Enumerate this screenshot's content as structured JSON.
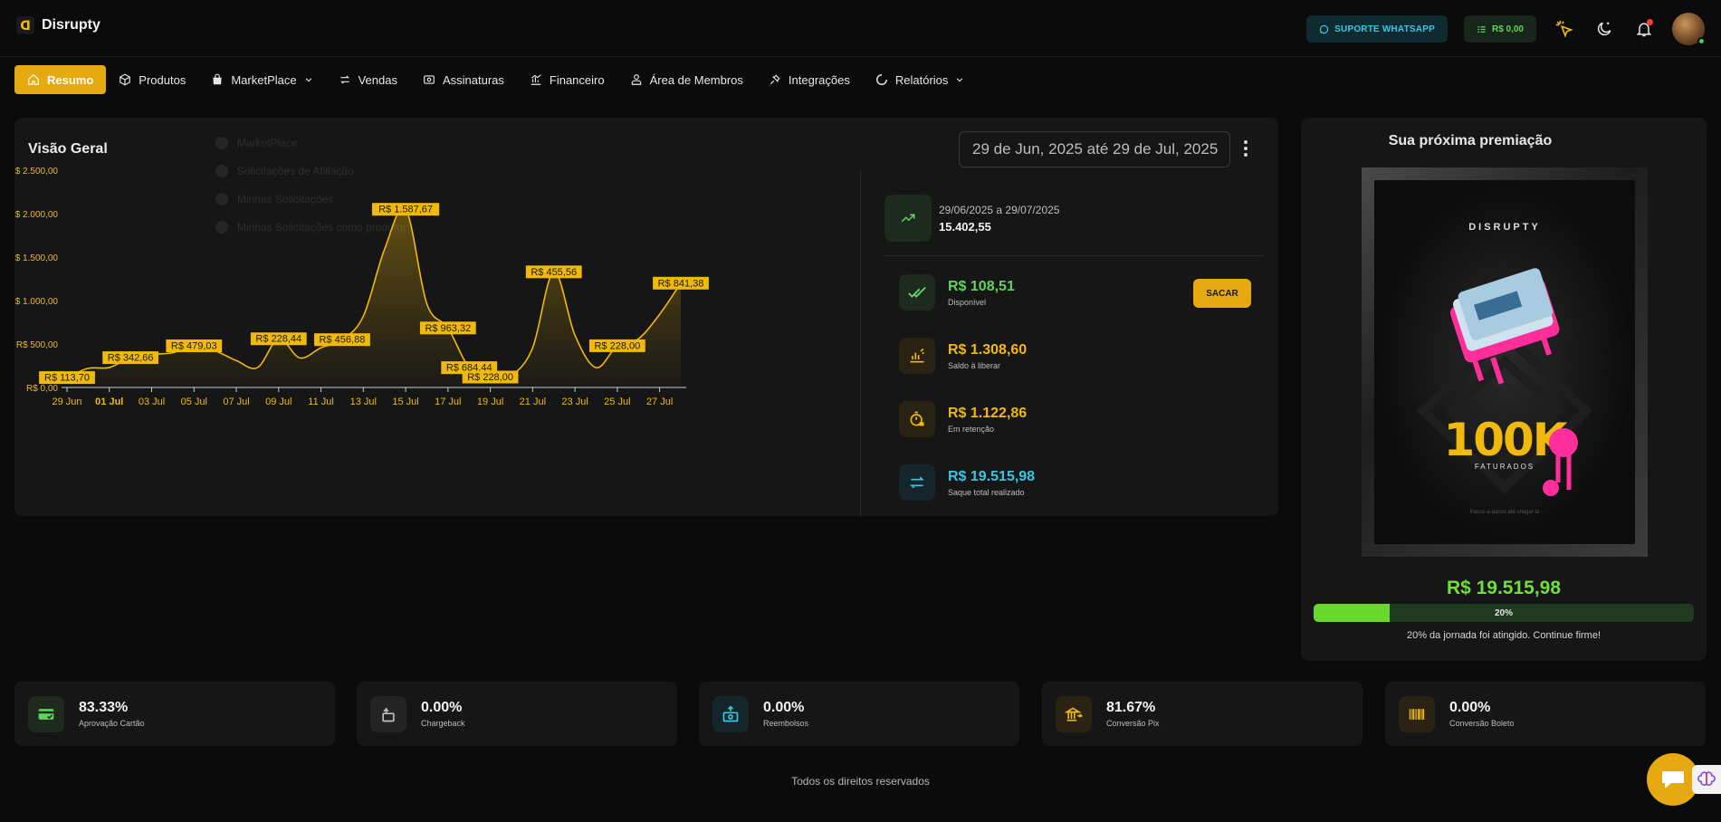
{
  "app": {
    "name": "Disrupty"
  },
  "topbar": {
    "support_label": "SUPORTE WHATSAPP",
    "balance_label": "R$ 0,00"
  },
  "nav": [
    {
      "label": "Resumo",
      "icon": "home-icon",
      "active": true
    },
    {
      "label": "Produtos",
      "icon": "box-icon"
    },
    {
      "label": "MarketPlace",
      "icon": "shopping-bag-icon",
      "dropdown": true
    },
    {
      "label": "Vendas",
      "icon": "arrows-swap-icon"
    },
    {
      "label": "Assinaturas",
      "icon": "subscription-icon"
    },
    {
      "label": "Financeiro",
      "icon": "finance-chart-icon"
    },
    {
      "label": "Área de Membros",
      "icon": "members-icon"
    },
    {
      "label": "Integrações",
      "icon": "plug-icon"
    },
    {
      "label": "Relatórios",
      "icon": "report-circle-icon",
      "dropdown": true
    }
  ],
  "overview": {
    "title": "Visão Geral",
    "date_range": "29 de Jun, 2025 até 29 de Jul, 2025",
    "legend": [
      "MarketPlace",
      "Solicitações de Afiliação",
      "Minhas Solicitações",
      "Minhas Solicitações como produtor"
    ]
  },
  "summary": {
    "range": "29/06/2025 a 29/07/2025",
    "total": "15.402,55"
  },
  "finance": [
    {
      "value": "R$ 108,51",
      "label": "Disponível",
      "color": "#62d35c",
      "icon": "double-check-icon"
    },
    {
      "value": "R$ 1.308,60",
      "label": "Saldo à liberar",
      "color": "#f0b90b",
      "icon": "hand-coins-icon"
    },
    {
      "value": "R$ 1.122,86",
      "label": "Em retenção",
      "color": "#f0b90b",
      "icon": "timer-lock-icon"
    },
    {
      "value": "R$ 19.515,98",
      "label": "Saque total realizado",
      "color": "#39c6e0",
      "icon": "transfer-icon"
    }
  ],
  "withdraw_label": "SACAR",
  "award": {
    "title": "Sua próxima premiação",
    "brand": "DISRUPTY",
    "headline": "100K",
    "sub": "FATURADOS",
    "footnote": "Passo-a-passo até chegar lá",
    "amount": "R$ 19.515,98",
    "progress": 0.2,
    "progress_label": "20%",
    "note": "20% da jornada foi atingido. Continue firme!"
  },
  "metrics": [
    {
      "value": "83.33%",
      "label": "Aprovação Cartão",
      "icon": "credit-card-check-icon",
      "color": "#62d35c"
    },
    {
      "value": "0.00%",
      "label": "Chargeback",
      "icon": "card-reverse-icon",
      "color": "#bdbdbd"
    },
    {
      "value": "0.00%",
      "label": "Reembolsos",
      "icon": "refund-icon",
      "color": "#39c6e0"
    },
    {
      "value": "81.67%",
      "label": "Conversão Pix",
      "icon": "bank-pix-icon",
      "color": "#f0b90b"
    },
    {
      "value": "0.00%",
      "label": "Conversão Boleto",
      "icon": "barcode-icon",
      "color": "#f0b90b"
    }
  ],
  "footer": "Todos os direitos reservados",
  "chart_data": {
    "type": "area",
    "x": [
      "29 Jun",
      "30 Jun",
      "01 Jul",
      "02 Jul",
      "03 Jul",
      "04 Jul",
      "05 Jul",
      "06 Jul",
      "07 Jul",
      "08 Jul",
      "09 Jul",
      "10 Jul",
      "11 Jul",
      "12 Jul",
      "13 Jul",
      "14 Jul",
      "15 Jul",
      "16 Jul",
      "17 Jul",
      "18 Jul",
      "19 Jul",
      "20 Jul",
      "21 Jul",
      "22 Jul",
      "23 Jul",
      "24 Jul",
      "25 Jul",
      "26 Jul",
      "27 Jul",
      "28 Jul"
    ],
    "values": [
      113.7,
      220,
      230,
      342.66,
      380,
      400,
      479.03,
      420,
      310,
      228.44,
      560,
      340,
      456.88,
      550,
      820,
      1587.67,
      2050,
      963.32,
      684.44,
      228.0,
      120,
      140,
      455.56,
      1330,
      600,
      228.0,
      480,
      560,
      841.38,
      1200
    ],
    "data_labels": [
      {
        "x": "29 Jun",
        "text": "R$ 113,70"
      },
      {
        "x": "02 Jul",
        "text": "R$ 342,66"
      },
      {
        "x": "05 Jul",
        "text": "R$ 479,03"
      },
      {
        "x": "09 Jul",
        "text": "R$ 228,44"
      },
      {
        "x": "12 Jul",
        "text": "R$ 456,88"
      },
      {
        "x": "15 Jul",
        "text": "R$ 1.587,67"
      },
      {
        "x": "17 Jul",
        "text": "R$ 963,32"
      },
      {
        "x": "18 Jul",
        "text": "R$ 684,44"
      },
      {
        "x": "19 Jul",
        "text": "R$ 228,00"
      },
      {
        "x": "22 Jul",
        "text": "R$ 455,56"
      },
      {
        "x": "25 Jul",
        "text": "R$ 228,00"
      },
      {
        "x": "28 Jul",
        "text": "R$ 841,38"
      }
    ],
    "x_ticks": [
      "29 Jun",
      "01 Jul",
      "03 Jul",
      "05 Jul",
      "07 Jul",
      "09 Jul",
      "11 Jul",
      "13 Jul",
      "15 Jul",
      "17 Jul",
      "19 Jul",
      "21 Jul",
      "23 Jul",
      "25 Jul",
      "27 Jul"
    ],
    "y_ticks": [
      {
        "value": 0,
        "label": "R$ 0,00"
      },
      {
        "value": 500,
        "label": "R$ 500,00"
      },
      {
        "value": 1000,
        "label": "R$ 1.000,00"
      },
      {
        "value": 1500,
        "label": "R$ 1.500,00"
      },
      {
        "value": 2000,
        "label": "R$ 2.000,00"
      },
      {
        "value": 2500,
        "label": "R$ 2.500,00"
      }
    ],
    "ylim": [
      0,
      2500
    ],
    "grid": false,
    "color": "#f0b90b"
  }
}
